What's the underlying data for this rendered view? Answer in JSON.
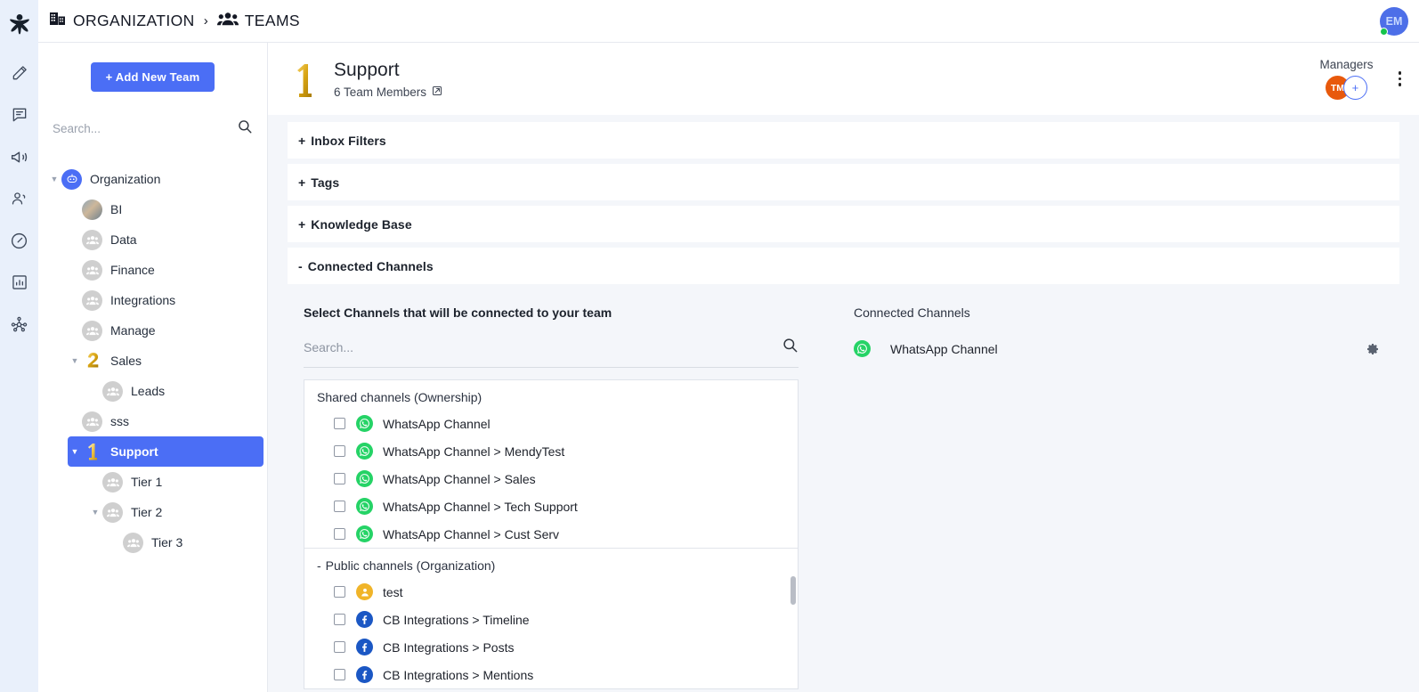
{
  "rail": {
    "logo_icon": "brand-logo-icon",
    "items": [
      {
        "name": "compose-pencil-icon"
      },
      {
        "name": "conversations-icon"
      },
      {
        "name": "campaigns-megaphone-icon"
      },
      {
        "name": "contacts-icon"
      },
      {
        "name": "performance-gauge-icon"
      },
      {
        "name": "reports-bar-chart-icon"
      },
      {
        "name": "integrations-network-icon"
      }
    ]
  },
  "topbar": {
    "breadcrumb": {
      "org_label": "ORGANIZATION",
      "separator": "›",
      "teams_label": "TEAMS"
    },
    "user_avatar_initials": "EM"
  },
  "sidebar": {
    "add_team_label": "+ Add New Team",
    "search_placeholder": "Search...",
    "search_value": "",
    "tree": [
      {
        "label": "Organization",
        "level": 0,
        "icon": "bot-avatar",
        "caret": "▼",
        "selected": false
      },
      {
        "label": "BI",
        "level": 1,
        "icon": "photo-avatar",
        "caret": "",
        "selected": false
      },
      {
        "label": "Data",
        "level": 1,
        "icon": "team-avatar",
        "caret": "",
        "selected": false
      },
      {
        "label": "Finance",
        "level": 1,
        "icon": "team-avatar",
        "caret": "",
        "selected": false
      },
      {
        "label": "Integrations",
        "level": 1,
        "icon": "team-avatar",
        "caret": "",
        "selected": false
      },
      {
        "label": "Manage",
        "level": 1,
        "icon": "team-avatar",
        "caret": "",
        "selected": false
      },
      {
        "label": "Sales",
        "level": 1,
        "icon": "medal-2",
        "caret": "▼",
        "selected": false
      },
      {
        "label": "Leads",
        "level": 2,
        "icon": "team-avatar",
        "caret": "",
        "selected": false
      },
      {
        "label": "sss",
        "level": 1,
        "icon": "team-avatar",
        "caret": "",
        "selected": false
      },
      {
        "label": "Support",
        "level": 1,
        "icon": "medal-1",
        "caret": "▼",
        "selected": true
      },
      {
        "label": "Tier 1",
        "level": 2,
        "icon": "team-avatar",
        "caret": "",
        "selected": false
      },
      {
        "label": "Tier 2",
        "level": 2,
        "icon": "team-avatar",
        "caret": "▼",
        "selected": false
      },
      {
        "label": "Tier 3",
        "level": 3,
        "icon": "team-avatar",
        "caret": "",
        "selected": false
      }
    ]
  },
  "team_header": {
    "rank_icon": "medal-1",
    "title": "Support",
    "members_text": "6 Team Members",
    "members_edit_icon": "external-link-icon",
    "managers_label": "Managers",
    "managers": [
      {
        "initials": "TM"
      }
    ],
    "add_manager_label": "+",
    "menu_icon": "kebab-menu-icon"
  },
  "accordions": [
    {
      "sign": "+",
      "label": "Inbox Filters",
      "expanded": false
    },
    {
      "sign": "+",
      "label": "Tags",
      "expanded": false
    },
    {
      "sign": "+",
      "label": "Knowledge Base",
      "expanded": false
    },
    {
      "sign": "-",
      "label": "Connected Channels",
      "expanded": true
    }
  ],
  "channel_picker": {
    "title": "Select Channels that will be connected to your team",
    "search_placeholder": "Search...",
    "search_value": "",
    "search_icon": "search-icon",
    "groups": [
      {
        "label": "Shared channels (Ownership)",
        "sign": "",
        "items": [
          {
            "label": "WhatsApp Channel",
            "icon": "whatsapp-icon",
            "checked": false
          },
          {
            "label": "WhatsApp Channel > MendyTest",
            "icon": "whatsapp-icon",
            "checked": false
          },
          {
            "label": "WhatsApp Channel > Sales",
            "icon": "whatsapp-icon",
            "checked": false
          },
          {
            "label": "WhatsApp Channel > Tech Support",
            "icon": "whatsapp-icon",
            "checked": false
          },
          {
            "label": "WhatsApp Channel > Cust Serv",
            "icon": "whatsapp-icon",
            "checked": false
          }
        ]
      },
      {
        "label": "Public channels (Organization)",
        "sign": "-",
        "items": [
          {
            "label": "test",
            "icon": "person-icon",
            "checked": false
          },
          {
            "label": "CB Integrations > Timeline",
            "icon": "facebook-icon",
            "checked": false
          },
          {
            "label": "CB Integrations > Posts",
            "icon": "facebook-icon",
            "checked": false
          },
          {
            "label": "CB Integrations > Mentions",
            "icon": "facebook-icon",
            "checked": false
          }
        ]
      }
    ]
  },
  "connected_panel": {
    "title": "Connected Channels",
    "items": [
      {
        "label": "WhatsApp Channel",
        "icon": "whatsapp-icon",
        "settings_icon": "gear-icon"
      }
    ]
  },
  "colors": {
    "accent": "#4b6ef5",
    "rail_bg": "#e9f0fb",
    "page_bg": "#f4f6fa",
    "whatsapp": "#25d366",
    "facebook": "#1b57c4",
    "manager_avatar": "#e8590c",
    "user_avatar": "#4d6fe8",
    "status_online": "#16c44c",
    "medal_gold": "#d9a514"
  }
}
